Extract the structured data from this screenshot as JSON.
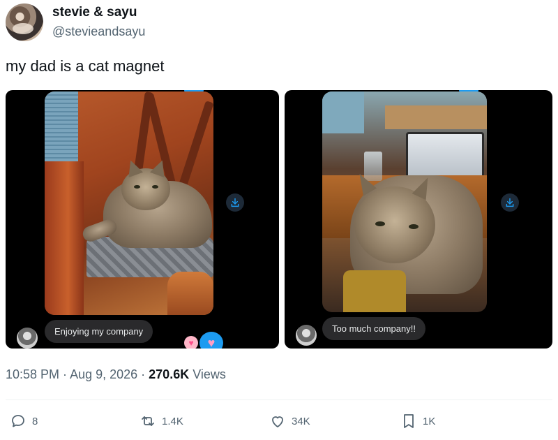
{
  "author": {
    "display_name": "stevie & sayu",
    "handle": "@stevieandsayu"
  },
  "tweet": {
    "text": "my dad is a cat magnet"
  },
  "media": [
    {
      "message": "Enjoying my company",
      "reactions": [
        "pink-heart",
        "blue-heart"
      ]
    },
    {
      "message": "Too much company!!"
    }
  ],
  "meta": {
    "time": "10:58 PM",
    "separator1": " · ",
    "date": "Aug 9, 2026",
    "separator2": " · ",
    "views_count": "270.6K",
    "views_label": " Views"
  },
  "actions": {
    "replies": "8",
    "reposts": "1.4K",
    "likes": "34K",
    "bookmarks": "1K"
  },
  "colors": {
    "text": "#0f1419",
    "secondary": "#536471",
    "accent": "#1d9bf0",
    "bubble": "#2a2a2c"
  }
}
